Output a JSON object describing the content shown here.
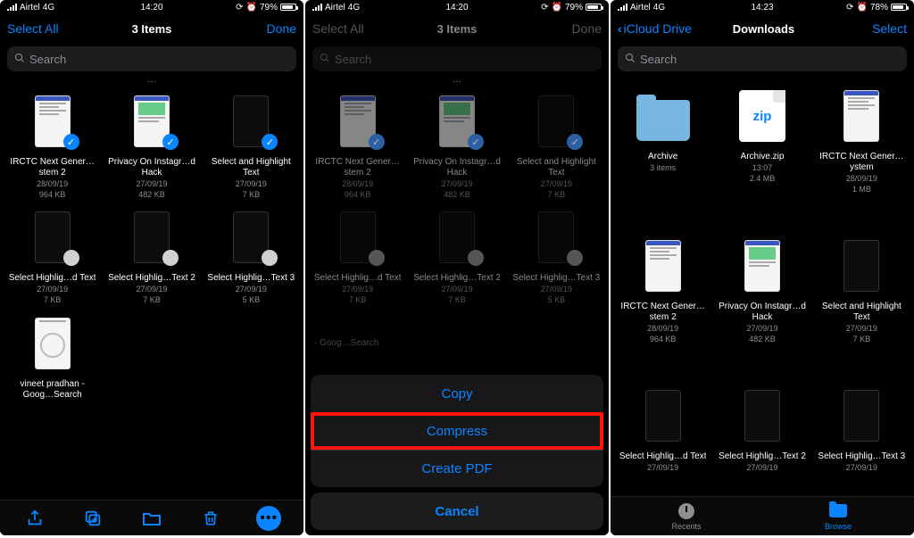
{
  "screens": [
    {
      "status": {
        "carrier": "Airtel",
        "network": "4G",
        "time": "14:20",
        "battery": "79%"
      },
      "nav": {
        "left": "Select All",
        "center": "3 Items",
        "right": "Done",
        "dim": false,
        "back": false
      },
      "search": {
        "placeholder": "Search"
      },
      "truncated": true,
      "files": [
        {
          "name": "IRCTC Next Gener…stem 2",
          "date": "28/09/19",
          "size": "964 KB",
          "thumb": "doc1",
          "badge": "checked"
        },
        {
          "name": "Privacy On Instagr…d Hack",
          "date": "27/09/19",
          "size": "482 KB",
          "thumb": "doc2",
          "badge": "checked"
        },
        {
          "name": "Select and Highlight Text",
          "date": "27/09/19",
          "size": "7 KB",
          "thumb": "dark",
          "badge": "checked"
        },
        {
          "name": "Select Highlig…d Text",
          "date": "27/09/19",
          "size": "7 KB",
          "thumb": "dark",
          "badge": "unchecked"
        },
        {
          "name": "Select Highlig…Text 2",
          "date": "27/09/19",
          "size": "7 KB",
          "thumb": "dark",
          "badge": "unchecked"
        },
        {
          "name": "Select Highlig…Text 3",
          "date": "27/09/19",
          "size": "5 KB",
          "thumb": "dark",
          "badge": "unchecked"
        },
        {
          "name": "vineet pradhan - Goog…Search",
          "date": "",
          "size": "",
          "thumb": "pradhan",
          "badge": "none"
        }
      ],
      "toolbar": [
        "share",
        "duplicate",
        "move",
        "trash",
        "more"
      ]
    },
    {
      "status": {
        "carrier": "Airtel",
        "network": "4G",
        "time": "14:20",
        "battery": "79%"
      },
      "nav": {
        "left": "Select All",
        "center": "3 Items",
        "right": "Done",
        "dim": true,
        "back": false
      },
      "search": {
        "placeholder": "Search"
      },
      "truncated": true,
      "dim": true,
      "files": [
        {
          "name": "IRCTC Next Gener…stem 2",
          "date": "28/09/19",
          "size": "964 KB",
          "thumb": "doc1",
          "badge": "checked"
        },
        {
          "name": "Privacy On Instagr…d Hack",
          "date": "27/09/19",
          "size": "482 KB",
          "thumb": "doc2",
          "badge": "checked"
        },
        {
          "name": "Select and Highlight Text",
          "date": "27/09/19",
          "size": "7 KB",
          "thumb": "dark",
          "badge": "checked"
        },
        {
          "name": "Select Highlig…d Text",
          "date": "27/09/19",
          "size": "7 KB",
          "thumb": "dark",
          "badge": "unchecked"
        },
        {
          "name": "Select Highlig…Text 2",
          "date": "27/09/19",
          "size": "7 KB",
          "thumb": "dark",
          "badge": "unchecked"
        },
        {
          "name": "Select Highlig…Text 3",
          "date": "27/09/19",
          "size": "5 KB",
          "thumb": "dark",
          "badge": "unchecked"
        }
      ],
      "ghost": "- Goog…Search",
      "actions": [
        "Copy",
        "Compress",
        "Create PDF"
      ],
      "highlight_index": 1,
      "cancel": "Cancel"
    },
    {
      "status": {
        "carrier": "Airtel",
        "network": "4G",
        "time": "14:23",
        "battery": "78%"
      },
      "nav": {
        "left": "iCloud Drive",
        "center": "Downloads",
        "right": "Select",
        "back": true
      },
      "search": {
        "placeholder": "Search"
      },
      "files": [
        {
          "name": "Archive",
          "date": "3 items",
          "size": "",
          "thumb": "folder"
        },
        {
          "name": "Archive.zip",
          "date": "13:07",
          "size": "2.4 MB",
          "thumb": "zip"
        },
        {
          "name": "IRCTC Next Gener…ystem",
          "date": "28/09/19",
          "size": "1 MB",
          "thumb": "doc1"
        },
        {
          "name": "IRCTC Next Gener…stem 2",
          "date": "28/09/19",
          "size": "964 KB",
          "thumb": "doc1"
        },
        {
          "name": "Privacy On Instagr…d Hack",
          "date": "27/09/19",
          "size": "482 KB",
          "thumb": "doc2"
        },
        {
          "name": "Select and Highlight Text",
          "date": "27/09/19",
          "size": "7 KB",
          "thumb": "dark"
        },
        {
          "name": "Select Highlig…d Text",
          "date": "27/09/19",
          "size": "",
          "thumb": "dark"
        },
        {
          "name": "Select Highlig…Text 2",
          "date": "27/09/19",
          "size": "",
          "thumb": "dark"
        },
        {
          "name": "Select Highlig…Text 3",
          "date": "27/09/19",
          "size": "",
          "thumb": "dark"
        }
      ],
      "tabs": {
        "recents": "Recents",
        "browse": "Browse",
        "active": "browse"
      }
    }
  ],
  "zip_label": "zip",
  "alarm_glyph": "⏰"
}
